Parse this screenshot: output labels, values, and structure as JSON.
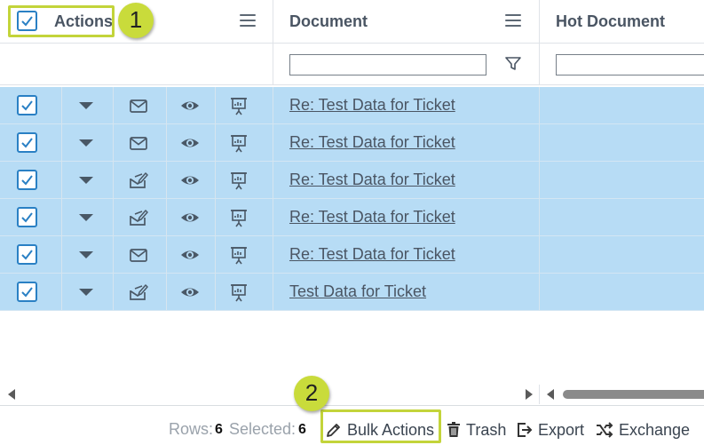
{
  "columns": {
    "actions_label": "Actions",
    "document_label": "Document",
    "hot_document_label": "Hot Document"
  },
  "filters": {
    "document_filter_value": "",
    "hot_document_filter_value": ""
  },
  "rows": [
    {
      "document": "Re: Test Data for Ticket",
      "message_icon": "envelope-icon",
      "selected": true
    },
    {
      "document": "Re: Test Data for Ticket",
      "message_icon": "envelope-icon",
      "selected": true
    },
    {
      "document": "Re: Test Data for Ticket",
      "message_icon": "envelope-edit-icon",
      "selected": true
    },
    {
      "document": "Re: Test Data for Ticket",
      "message_icon": "envelope-edit-icon",
      "selected": true
    },
    {
      "document": "Re: Test Data for Ticket",
      "message_icon": "envelope-icon",
      "selected": true
    },
    {
      "document": "Test Data for Ticket",
      "message_icon": "envelope-edit-icon",
      "selected": true
    }
  ],
  "footer": {
    "rows_label": "Rows:",
    "rows_value": "6",
    "selected_label": "Selected:",
    "selected_value": "6",
    "bulk_actions_label": "Bulk Actions",
    "trash_label": "Trash",
    "export_label": "Export",
    "exchange_label": "Exchange"
  },
  "callouts": {
    "one": "1",
    "two": "2"
  },
  "colors": {
    "selected_row": "#b7dcf5",
    "checkbox": "#2a80c4",
    "callout": "#c9db3b"
  }
}
